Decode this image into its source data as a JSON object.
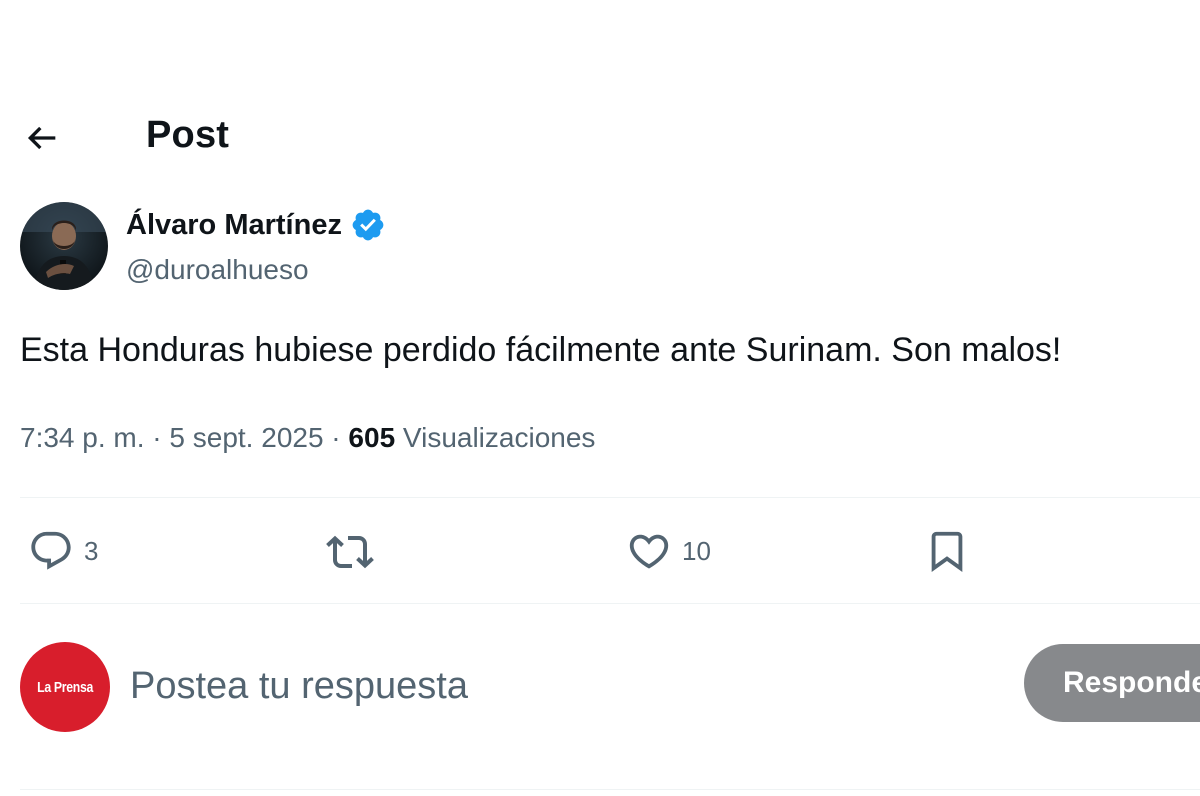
{
  "header": {
    "title": "Post",
    "back_icon": "arrow-left-icon"
  },
  "post": {
    "author": {
      "name": "Álvaro Martínez",
      "handle": "@duroalhueso",
      "verified": true,
      "verified_color": "#1d9bf0"
    },
    "text": "Esta Honduras hubiese perdido fácilmente ante Surinam. Son malos!",
    "meta": {
      "time": "7:34 p. m.",
      "separator": " · ",
      "date": "5 sept. 2025",
      "views_count": "605",
      "views_label": "Visualizaciones"
    },
    "actions": {
      "replies": {
        "icon": "reply-icon",
        "count": "3"
      },
      "reposts": {
        "icon": "repost-icon",
        "count": ""
      },
      "likes": {
        "icon": "heart-icon",
        "count": "10"
      },
      "bookmark": {
        "icon": "bookmark-icon"
      }
    }
  },
  "reply_bar": {
    "avatar_text": "La Prensa",
    "avatar_color": "#d81e2c",
    "placeholder": "Postea tu respuesta",
    "button_label": "Responder"
  },
  "colors": {
    "text_primary": "#0f1419",
    "text_secondary": "#536471",
    "divider": "#eff3f4",
    "button_disabled": "#87898c"
  }
}
